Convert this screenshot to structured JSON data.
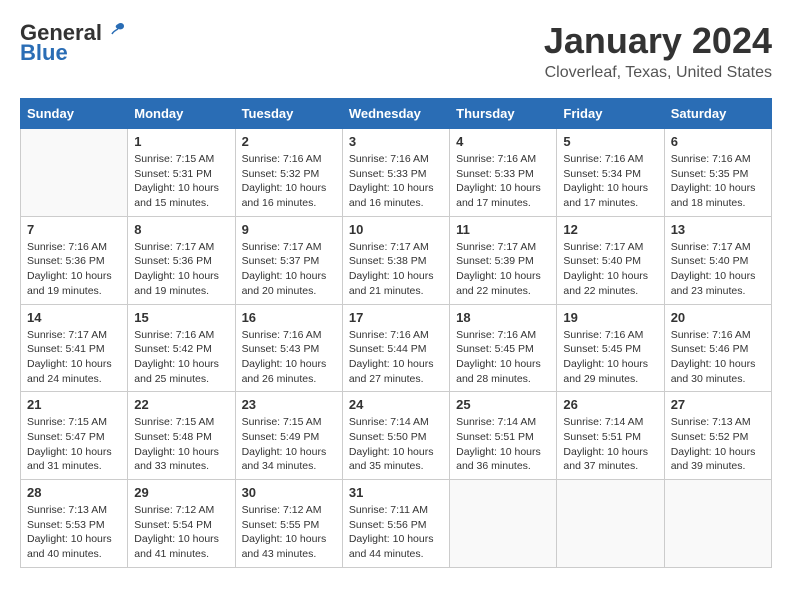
{
  "header": {
    "logo_general": "General",
    "logo_blue": "Blue",
    "title": "January 2024",
    "subtitle": "Cloverleaf, Texas, United States"
  },
  "days_of_week": [
    "Sunday",
    "Monday",
    "Tuesday",
    "Wednesday",
    "Thursday",
    "Friday",
    "Saturday"
  ],
  "weeks": [
    [
      {
        "day": "",
        "info": ""
      },
      {
        "day": "1",
        "info": "Sunrise: 7:15 AM\nSunset: 5:31 PM\nDaylight: 10 hours\nand 15 minutes."
      },
      {
        "day": "2",
        "info": "Sunrise: 7:16 AM\nSunset: 5:32 PM\nDaylight: 10 hours\nand 16 minutes."
      },
      {
        "day": "3",
        "info": "Sunrise: 7:16 AM\nSunset: 5:33 PM\nDaylight: 10 hours\nand 16 minutes."
      },
      {
        "day": "4",
        "info": "Sunrise: 7:16 AM\nSunset: 5:33 PM\nDaylight: 10 hours\nand 17 minutes."
      },
      {
        "day": "5",
        "info": "Sunrise: 7:16 AM\nSunset: 5:34 PM\nDaylight: 10 hours\nand 17 minutes."
      },
      {
        "day": "6",
        "info": "Sunrise: 7:16 AM\nSunset: 5:35 PM\nDaylight: 10 hours\nand 18 minutes."
      }
    ],
    [
      {
        "day": "7",
        "info": "Sunrise: 7:16 AM\nSunset: 5:36 PM\nDaylight: 10 hours\nand 19 minutes."
      },
      {
        "day": "8",
        "info": "Sunrise: 7:17 AM\nSunset: 5:36 PM\nDaylight: 10 hours\nand 19 minutes."
      },
      {
        "day": "9",
        "info": "Sunrise: 7:17 AM\nSunset: 5:37 PM\nDaylight: 10 hours\nand 20 minutes."
      },
      {
        "day": "10",
        "info": "Sunrise: 7:17 AM\nSunset: 5:38 PM\nDaylight: 10 hours\nand 21 minutes."
      },
      {
        "day": "11",
        "info": "Sunrise: 7:17 AM\nSunset: 5:39 PM\nDaylight: 10 hours\nand 22 minutes."
      },
      {
        "day": "12",
        "info": "Sunrise: 7:17 AM\nSunset: 5:40 PM\nDaylight: 10 hours\nand 22 minutes."
      },
      {
        "day": "13",
        "info": "Sunrise: 7:17 AM\nSunset: 5:40 PM\nDaylight: 10 hours\nand 23 minutes."
      }
    ],
    [
      {
        "day": "14",
        "info": "Sunrise: 7:17 AM\nSunset: 5:41 PM\nDaylight: 10 hours\nand 24 minutes."
      },
      {
        "day": "15",
        "info": "Sunrise: 7:16 AM\nSunset: 5:42 PM\nDaylight: 10 hours\nand 25 minutes."
      },
      {
        "day": "16",
        "info": "Sunrise: 7:16 AM\nSunset: 5:43 PM\nDaylight: 10 hours\nand 26 minutes."
      },
      {
        "day": "17",
        "info": "Sunrise: 7:16 AM\nSunset: 5:44 PM\nDaylight: 10 hours\nand 27 minutes."
      },
      {
        "day": "18",
        "info": "Sunrise: 7:16 AM\nSunset: 5:45 PM\nDaylight: 10 hours\nand 28 minutes."
      },
      {
        "day": "19",
        "info": "Sunrise: 7:16 AM\nSunset: 5:45 PM\nDaylight: 10 hours\nand 29 minutes."
      },
      {
        "day": "20",
        "info": "Sunrise: 7:16 AM\nSunset: 5:46 PM\nDaylight: 10 hours\nand 30 minutes."
      }
    ],
    [
      {
        "day": "21",
        "info": "Sunrise: 7:15 AM\nSunset: 5:47 PM\nDaylight: 10 hours\nand 31 minutes."
      },
      {
        "day": "22",
        "info": "Sunrise: 7:15 AM\nSunset: 5:48 PM\nDaylight: 10 hours\nand 33 minutes."
      },
      {
        "day": "23",
        "info": "Sunrise: 7:15 AM\nSunset: 5:49 PM\nDaylight: 10 hours\nand 34 minutes."
      },
      {
        "day": "24",
        "info": "Sunrise: 7:14 AM\nSunset: 5:50 PM\nDaylight: 10 hours\nand 35 minutes."
      },
      {
        "day": "25",
        "info": "Sunrise: 7:14 AM\nSunset: 5:51 PM\nDaylight: 10 hours\nand 36 minutes."
      },
      {
        "day": "26",
        "info": "Sunrise: 7:14 AM\nSunset: 5:51 PM\nDaylight: 10 hours\nand 37 minutes."
      },
      {
        "day": "27",
        "info": "Sunrise: 7:13 AM\nSunset: 5:52 PM\nDaylight: 10 hours\nand 39 minutes."
      }
    ],
    [
      {
        "day": "28",
        "info": "Sunrise: 7:13 AM\nSunset: 5:53 PM\nDaylight: 10 hours\nand 40 minutes."
      },
      {
        "day": "29",
        "info": "Sunrise: 7:12 AM\nSunset: 5:54 PM\nDaylight: 10 hours\nand 41 minutes."
      },
      {
        "day": "30",
        "info": "Sunrise: 7:12 AM\nSunset: 5:55 PM\nDaylight: 10 hours\nand 43 minutes."
      },
      {
        "day": "31",
        "info": "Sunrise: 7:11 AM\nSunset: 5:56 PM\nDaylight: 10 hours\nand 44 minutes."
      },
      {
        "day": "",
        "info": ""
      },
      {
        "day": "",
        "info": ""
      },
      {
        "day": "",
        "info": ""
      }
    ]
  ]
}
